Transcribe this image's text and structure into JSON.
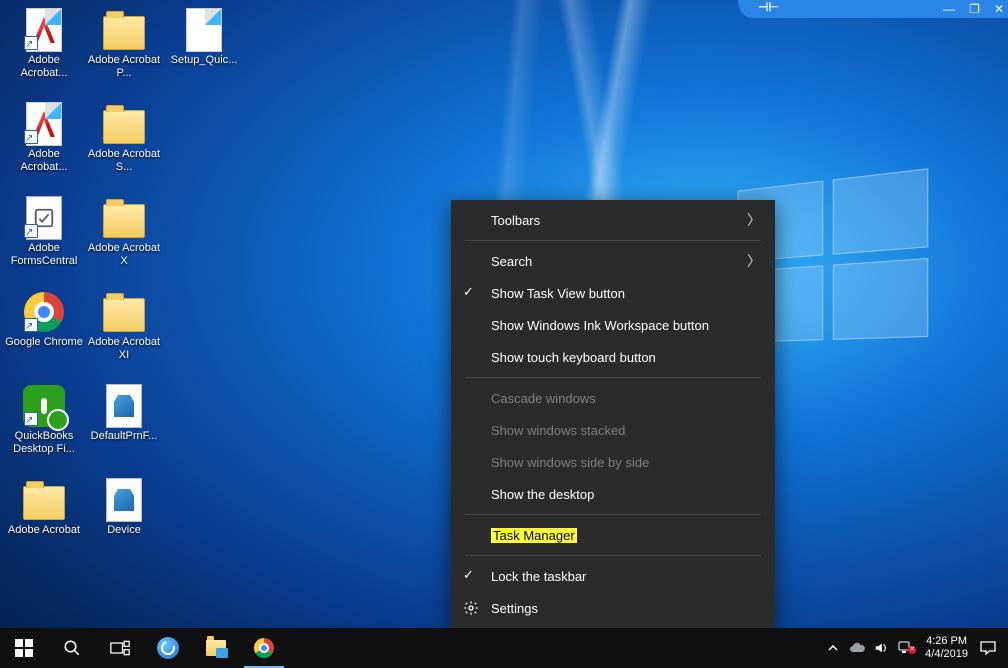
{
  "vm_bar": {
    "pin": "⊣⊢",
    "min": "—",
    "max": "❐",
    "close": "✕"
  },
  "desktop_icons": [
    {
      "name": "adobe-acrobat",
      "label": "Adobe Acrobat...",
      "art": "adobe",
      "shortcut": true
    },
    {
      "name": "adobe-acrobat-p",
      "label": "Adobe Acrobat P...",
      "art": "folder",
      "shortcut": false
    },
    {
      "name": "setup-quic",
      "label": "Setup_Quic...",
      "art": "page",
      "shortcut": false
    },
    {
      "name": "adobe-acrobat-2",
      "label": "Adobe Acrobat...",
      "art": "adobe",
      "shortcut": true
    },
    {
      "name": "adobe-acrobat-s",
      "label": "Adobe Acrobat S...",
      "art": "folder",
      "shortcut": false
    },
    {
      "name": "blank-1",
      "label": "",
      "art": "",
      "shortcut": false
    },
    {
      "name": "adobe-formscentral",
      "label": "Adobe FormsCentral",
      "art": "form",
      "shortcut": true
    },
    {
      "name": "adobe-acrobat-x",
      "label": "Adobe Acrobat X",
      "art": "folder",
      "shortcut": false
    },
    {
      "name": "blank-2",
      "label": "",
      "art": "",
      "shortcut": false
    },
    {
      "name": "google-chrome",
      "label": "Google Chrome",
      "art": "chrome",
      "shortcut": true
    },
    {
      "name": "adobe-acrobat-xi",
      "label": "Adobe Acrobat XI",
      "art": "folder",
      "shortcut": false
    },
    {
      "name": "blank-3",
      "label": "",
      "art": "",
      "shortcut": false
    },
    {
      "name": "quickbooks-desktop-fi",
      "label": "QuickBooks Desktop Fi...",
      "art": "qb",
      "shortcut": true
    },
    {
      "name": "defaultprnf",
      "label": "DefaultPrnF...",
      "art": "dev",
      "shortcut": false
    },
    {
      "name": "blank-4",
      "label": "",
      "art": "",
      "shortcut": false
    },
    {
      "name": "adobe-acrobat-3",
      "label": "Adobe Acrobat",
      "art": "folder",
      "shortcut": false
    },
    {
      "name": "device",
      "label": "Device",
      "art": "dev",
      "shortcut": false
    }
  ],
  "context_menu": {
    "items": [
      {
        "id": "toolbars",
        "label": "Toolbars",
        "submenu": true,
        "checked": false,
        "disabled": false
      },
      {
        "sep": true
      },
      {
        "id": "search",
        "label": "Search",
        "submenu": true,
        "checked": false,
        "disabled": false
      },
      {
        "id": "show-task-view",
        "label": "Show Task View button",
        "submenu": false,
        "checked": true,
        "disabled": false
      },
      {
        "id": "show-ink",
        "label": "Show Windows Ink Workspace button",
        "submenu": false,
        "checked": false,
        "disabled": false
      },
      {
        "id": "show-touch-kb",
        "label": "Show touch keyboard button",
        "submenu": false,
        "checked": false,
        "disabled": false
      },
      {
        "sep": true
      },
      {
        "id": "cascade",
        "label": "Cascade windows",
        "submenu": false,
        "checked": false,
        "disabled": true
      },
      {
        "id": "stacked",
        "label": "Show windows stacked",
        "submenu": false,
        "checked": false,
        "disabled": true
      },
      {
        "id": "sidebyside",
        "label": "Show windows side by side",
        "submenu": false,
        "checked": false,
        "disabled": true
      },
      {
        "id": "show-desktop",
        "label": "Show the desktop",
        "submenu": false,
        "checked": false,
        "disabled": false
      },
      {
        "sep": true
      },
      {
        "id": "task-manager",
        "label": "Task Manager",
        "submenu": false,
        "checked": false,
        "disabled": false,
        "highlight": true
      },
      {
        "sep": true
      },
      {
        "id": "lock-taskbar",
        "label": "Lock the taskbar",
        "submenu": false,
        "checked": true,
        "disabled": false
      },
      {
        "id": "settings",
        "label": "Settings",
        "submenu": false,
        "checked": false,
        "disabled": false,
        "icon": "gear"
      }
    ]
  },
  "taskbar": {
    "apps": [
      {
        "name": "internet-explorer",
        "art": "ie",
        "active": false
      },
      {
        "name": "file-explorer",
        "art": "explorer",
        "active": false
      },
      {
        "name": "google-chrome",
        "art": "chrome",
        "active": true
      }
    ]
  },
  "tray": {
    "time": "4:26 PM",
    "date": "4/4/2019"
  }
}
